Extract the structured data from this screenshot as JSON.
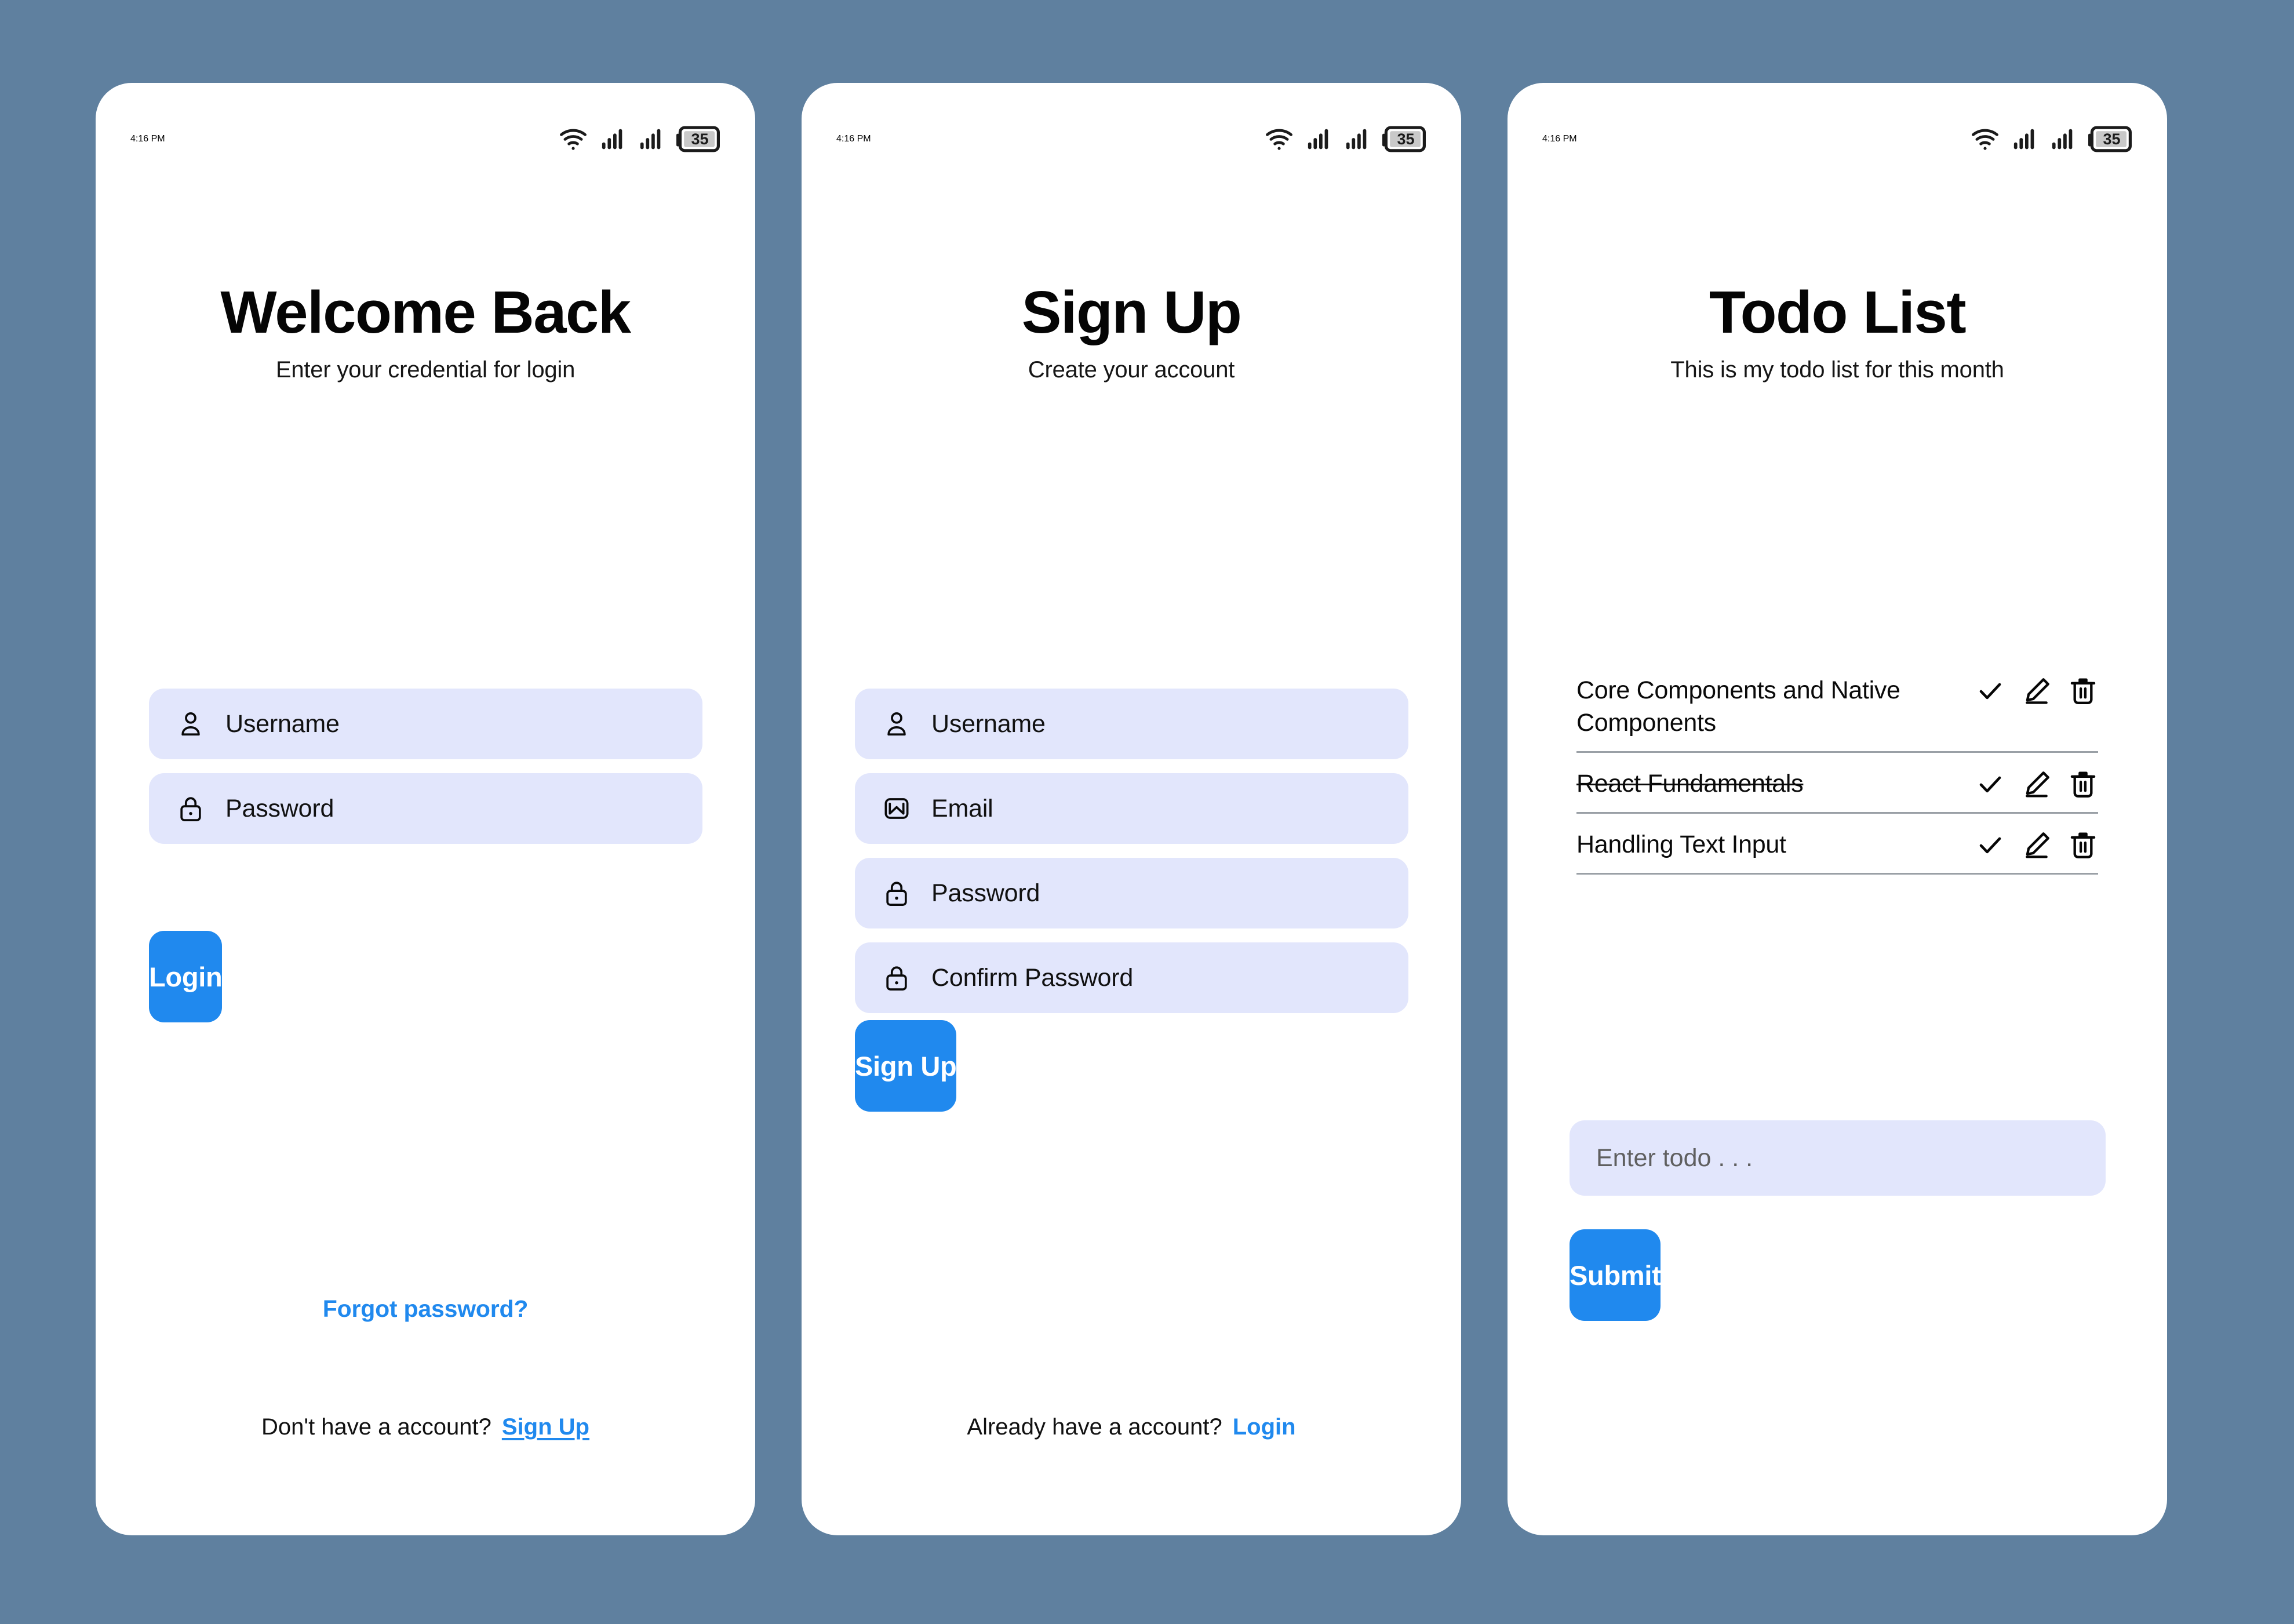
{
  "background_color": "#5f809f",
  "accent_color": "#2089ee",
  "field_bg_color": "#e2e6fc",
  "status_bar": {
    "time": "4:16 PM",
    "battery_level": "35",
    "icons": [
      "wifi-icon",
      "signal-icon",
      "signal-icon",
      "battery-icon"
    ]
  },
  "login": {
    "title": "Welcome Back",
    "subtitle": "Enter your credential for login",
    "fields": [
      {
        "icon": "person-icon",
        "label": "Username"
      },
      {
        "icon": "lock-icon",
        "label": "Password"
      }
    ],
    "submit_label": "Login",
    "forgot_password_label": "Forgot password?",
    "footer_text": "Don't have a account?",
    "footer_link": "Sign Up"
  },
  "signup": {
    "title": "Sign Up",
    "subtitle": "Create your account",
    "fields": [
      {
        "icon": "person-icon",
        "label": "Username"
      },
      {
        "icon": "mail-icon",
        "label": "Email"
      },
      {
        "icon": "lock-icon",
        "label": "Password"
      },
      {
        "icon": "lock-icon",
        "label": "Confirm Password"
      }
    ],
    "submit_label": "Sign Up",
    "footer_text": "Already have a account?",
    "footer_link": "Login"
  },
  "todo": {
    "title": "Todo List",
    "subtitle": "This is my todo list for this month",
    "items": [
      {
        "text": "Core Components and Native Components",
        "done": false
      },
      {
        "text": "React Fundamentals",
        "done": true
      },
      {
        "text": "Handling Text Input",
        "done": false
      }
    ],
    "input_value": "",
    "input_placeholder": "Enter todo . . .",
    "submit_label": "Submit",
    "item_actions": [
      "check-icon",
      "pencil-icon",
      "trash-icon"
    ]
  }
}
